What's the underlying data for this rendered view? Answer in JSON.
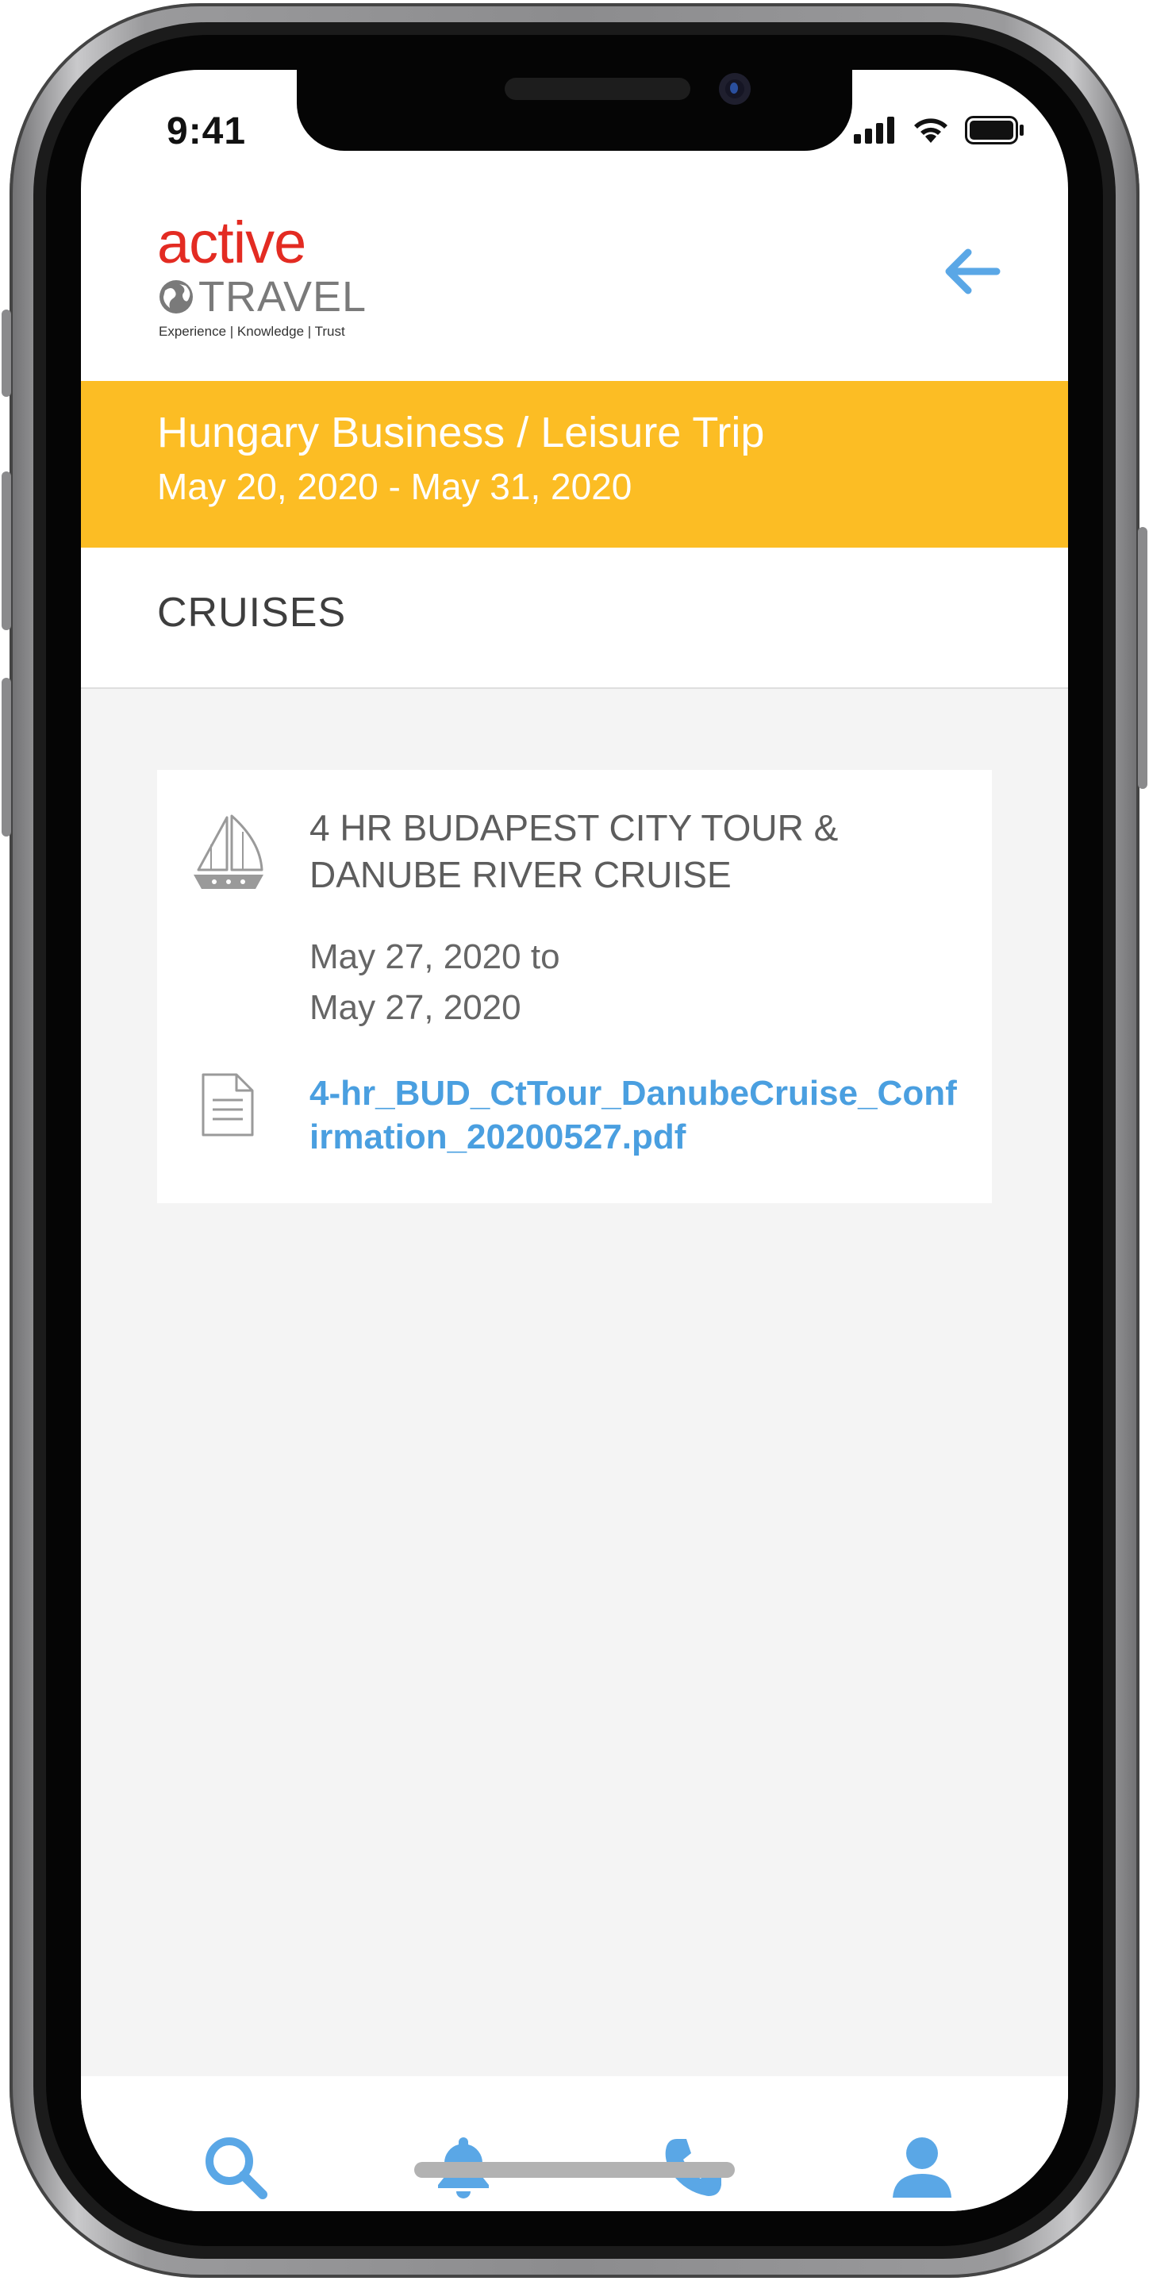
{
  "status_bar": {
    "time": "9:41"
  },
  "brand": {
    "name_top": "active",
    "name_bottom": "TRAVEL",
    "tagline": "Experience | Knowledge | Trust",
    "colors": {
      "red": "#e32b22",
      "gray": "#7a7a7a"
    }
  },
  "header": {
    "back_icon": "arrow-left-icon",
    "accent": "#5aa7e6"
  },
  "trip": {
    "title": "Hungary Business / Leisure Trip",
    "dates": "May 20, 2020 - May 31, 2020",
    "banner_color": "#fcbd24"
  },
  "section": {
    "title": "CRUISES"
  },
  "cruises": [
    {
      "icon": "sailboat-icon",
      "title": "4 HR BUDAPEST CITY TOUR & DANUBE RIVER CRUISE",
      "date_from": "May 27, 2020 to",
      "date_to": "May 27, 2020",
      "document_icon": "document-icon",
      "document": "4-hr_BUD_CtTour_DanubeCruise_Confirmation_20200527.pdf"
    }
  ],
  "tabbar": {
    "items": [
      {
        "icon": "search-icon"
      },
      {
        "icon": "bell-icon"
      },
      {
        "icon": "phone-icon"
      },
      {
        "icon": "user-icon"
      }
    ],
    "color": "#5aa7e6"
  }
}
